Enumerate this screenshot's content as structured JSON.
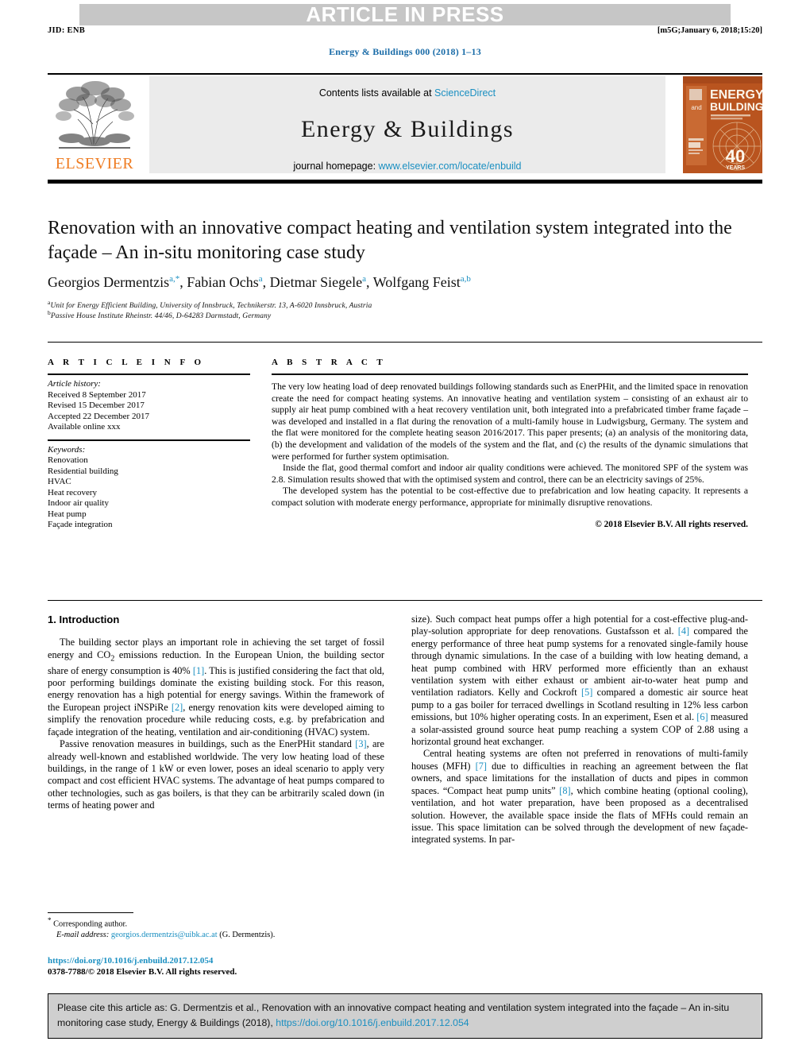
{
  "banner": {
    "article_in_press": "ARTICLE IN PRESS",
    "jid": "JID: ENB",
    "stamp": "[m5G;January 6, 2018;15:20]",
    "running_head": "Energy & Buildings 000 (2018) 1–13"
  },
  "masthead": {
    "publisher": "ELSEVIER",
    "contents_prefix": "Contents lists available at ",
    "contents_link": "ScienceDirect",
    "journal_name": "Energy & Buildings",
    "homepage_prefix": "journal homepage: ",
    "homepage_link": "www.elsevier.com/locate/enbuild",
    "cover": {
      "and": "and",
      "line1": "ENERGY",
      "line2": "BUILDINGS",
      "sub": "Science and Technology for Energy and Thermal Comfort",
      "anniversary": "40",
      "anniversary_sub": "YEARS"
    }
  },
  "article": {
    "title": "Renovation with an innovative compact heating and ventilation system integrated into the façade – An in-situ monitoring case study",
    "authors": [
      {
        "name": "Georgios Dermentzis",
        "marks": "a,*"
      },
      {
        "name": "Fabian Ochs",
        "marks": "a"
      },
      {
        "name": "Dietmar Siegele",
        "marks": "a"
      },
      {
        "name": "Wolfgang Feist",
        "marks": "a,b"
      }
    ],
    "affiliations": [
      {
        "mark": "a",
        "text": "Unit for Energy Efficient Building, University of Innsbruck, Technikerstr. 13, A-6020 Innsbruck, Austria"
      },
      {
        "mark": "b",
        "text": "Passive House Institute Rheinstr. 44/46, D-64283 Darmstadt, Germany"
      }
    ]
  },
  "article_info": {
    "heading": "A R T I C L E   I N F O",
    "history_label": "Article history:",
    "history": [
      "Received 8 September 2017",
      "Revised 15 December 2017",
      "Accepted 22 December 2017",
      "Available online xxx"
    ],
    "keywords_label": "Keywords:",
    "keywords": [
      "Renovation",
      "Residential building",
      "HVAC",
      "Heat recovery",
      "Indoor air quality",
      "Heat pump",
      "Façade integration"
    ]
  },
  "abstract": {
    "heading": "A B S T R A C T",
    "paragraphs": [
      "The very low heating load of deep renovated buildings following standards such as EnerPHit, and the limited space in renovation create the need for compact heating systems. An innovative heating and ventilation system – consisting of an exhaust air to supply air heat pump combined with a heat recovery ventilation unit, both integrated into a prefabricated timber frame façade – was developed and installed in a flat during the renovation of a multi-family house in Ludwigsburg, Germany. The system and the flat were monitored for the complete heating season 2016/2017. This paper presents; (a) an analysis of the monitoring data, (b) the development and validation of the models of the system and the flat, and (c) the results of the dynamic simulations that were performed for further system optimisation.",
      "Inside the flat, good thermal comfort and indoor air quality conditions were achieved. The monitored SPF of the system was 2.8. Simulation results showed that with the optimised system and control, there can be an electricity savings of 25%.",
      "The developed system has the potential to be cost-effective due to prefabrication and low heating capacity. It represents a compact solution with moderate energy performance, appropriate for minimally disruptive renovations."
    ],
    "copyright": "© 2018 Elsevier B.V. All rights reserved."
  },
  "body": {
    "section_heading": "1. Introduction",
    "left_paragraphs": [
      "The building sector plays an important role in achieving the set target of fossil energy and CO2 emissions reduction. In the European Union, the building sector share of energy consumption is 40% [1]. This is justified considering the fact that old, poor performing buildings dominate the existing building stock. For this reason, energy renovation has a high potential for energy savings. Within the framework of the European project iNSPiRe [2], energy renovation kits were developed aiming to simplify the renovation procedure while reducing costs, e.g. by prefabrication and façade integration of the heating, ventilation and air-conditioning (HVAC) system.",
      "Passive renovation measures in buildings, such as the EnerPHit standard [3], are already well-known and established worldwide. The very low heating load of these buildings, in the range of 1 kW or even lower, poses an ideal scenario to apply very compact and cost efficient HVAC systems. The advantage of heat pumps compared to other technologies, such as gas boilers, is that they can be arbitrarily scaled down (in terms of heating power and"
    ],
    "right_paragraphs": [
      "size). Such compact heat pumps offer a high potential for a cost-effective plug-and-play-solution appropriate for deep renovations. Gustafsson et al. [4] compared the energy performance of three heat pump systems for a renovated single-family house through dynamic simulations. In the case of a building with low heating demand, a heat pump combined with HRV performed more efficiently than an exhaust ventilation system with either exhaust or ambient air-to-water heat pump and ventilation radiators. Kelly and Cockroft [5] compared a domestic air source heat pump to a gas boiler for terraced dwellings in Scotland resulting in 12% less carbon emissions, but 10% higher operating costs. In an experiment, Esen et al. [6] measured a solar-assisted ground source heat pump reaching a system COP of 2.88 using a horizontal ground heat exchanger.",
      "Central heating systems are often not preferred in renovations of multi-family houses (MFH) [7] due to difficulties in reaching an agreement between the flat owners, and space limitations for the installation of ducts and pipes in common spaces. “Compact heat pump units” [8], which combine heating (optional cooling), ventilation, and hot water preparation, have been proposed as a decentralised solution. However, the available space inside the flats of MFHs could remain an issue. This space limitation can be solved through the development of new façade-integrated systems. In par-"
    ]
  },
  "footnotes": {
    "corresponding": "Corresponding author.",
    "email_label": "E-mail address:",
    "email": "georgios.dermentzis@uibk.ac.at",
    "email_suffix": "(G. Dermentzis).",
    "doi": "https://doi.org/10.1016/j.enbuild.2017.12.054",
    "issn_line": "0378-7788/© 2018 Elsevier B.V. All rights reserved."
  },
  "cite_box": {
    "text_before_link": "Please cite this article as: G. Dermentzis et al., Renovation with an innovative compact heating and ventilation system integrated into the façade – An in-situ monitoring case study, Energy & Buildings (2018), ",
    "link": "https://doi.org/10.1016/j.enbuild.2017.12.054"
  },
  "colors": {
    "link_blue": "#1a8fc1",
    "runhead_blue": "#1a6ca8",
    "banner_gray": "#c6c6c6",
    "masthead_gray": "#ebebeb",
    "cite_gray": "#cfcfcf",
    "elsevier_orange": "#ef7c22",
    "cover_orange": "#b9541f"
  }
}
